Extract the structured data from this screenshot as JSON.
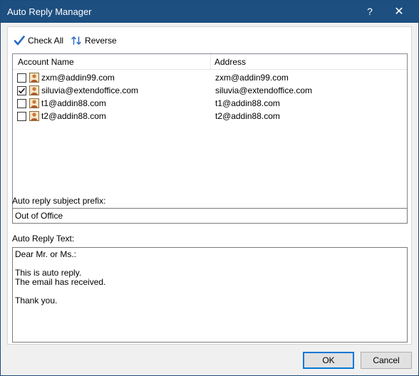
{
  "window": {
    "title": "Auto Reply Manager",
    "help_label": "?",
    "close_label": "✕"
  },
  "toolbar": {
    "check_all_label": "Check All",
    "reverse_label": "Reverse"
  },
  "accounts_list": {
    "columns": [
      "Account Name",
      "Address"
    ],
    "rows": [
      {
        "name": "zxm@addin99.com",
        "address": "zxm@addin99.com",
        "checked": false
      },
      {
        "name": "siluvia@extendoffice.com",
        "address": "siluvia@extendoffice.com",
        "checked": true
      },
      {
        "name": "t1@addin88.com",
        "address": "t1@addin88.com",
        "checked": false
      },
      {
        "name": "t2@addin88.com",
        "address": "t2@addin88.com",
        "checked": false
      }
    ]
  },
  "subject_prefix": {
    "label": "Auto reply subject prefix:",
    "value": "Out of Office"
  },
  "reply_text": {
    "label": "Auto Reply Text:",
    "value": "Dear Mr. or Ms.:\n\nThis is auto reply.\nThe email has received.\n\nThank you."
  },
  "buttons": {
    "ok_label": "OK",
    "cancel_label": "Cancel"
  },
  "colors": {
    "titlebar": "#1d4f81",
    "check_icon": "#2b6cc4",
    "default_button_border": "#0078d7"
  },
  "icons": {
    "check_all": "checkmark-icon",
    "reverse": "swap-arrows-icon",
    "account": "contact-card-icon"
  }
}
